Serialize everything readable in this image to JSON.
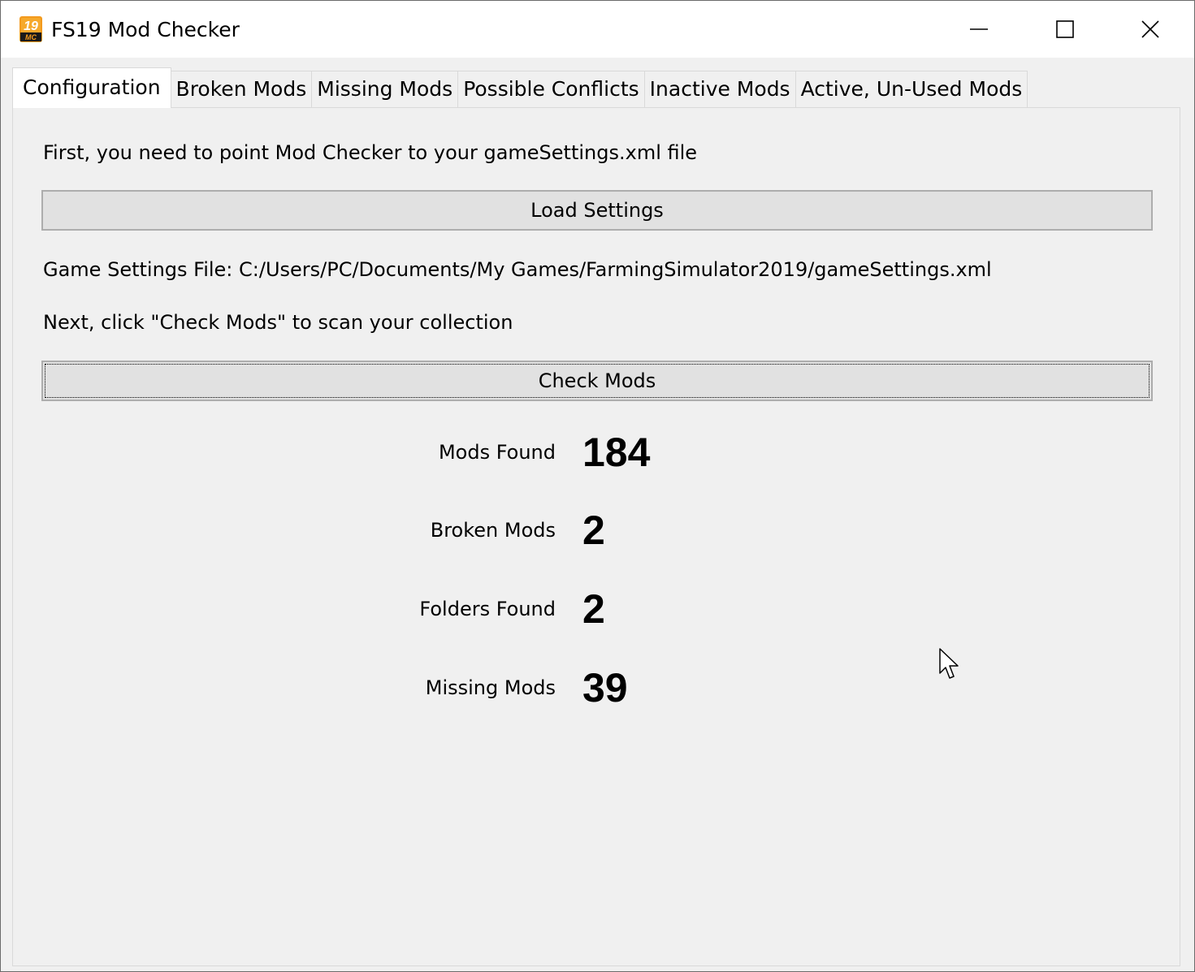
{
  "window": {
    "title": "FS19 Mod Checker",
    "icon_text": "19 MC"
  },
  "tabs": [
    {
      "label": "Configuration",
      "active": true
    },
    {
      "label": "Broken Mods",
      "active": false
    },
    {
      "label": "Missing Mods",
      "active": false
    },
    {
      "label": "Possible Conflicts",
      "active": false
    },
    {
      "label": "Inactive Mods",
      "active": false
    },
    {
      "label": "Active, Un-Used Mods",
      "active": false
    }
  ],
  "config": {
    "intro_text": "First, you need to point Mod Checker to your gameSettings.xml file",
    "load_button": "Load Settings",
    "settings_file_text": "Game Settings File: C:/Users/PC/Documents/My Games/FarmingSimulator2019/gameSettings.xml",
    "next_text": "Next, click \"Check Mods\" to scan your collection",
    "check_button": "Check Mods"
  },
  "stats": [
    {
      "label": "Mods Found",
      "value": "184"
    },
    {
      "label": "Broken Mods",
      "value": "2"
    },
    {
      "label": "Folders Found",
      "value": "2"
    },
    {
      "label": "Missing Mods",
      "value": "39"
    }
  ],
  "icons": {
    "app": "fs19-mod-checker-logo-icon",
    "minimize": "minimize-icon",
    "maximize": "maximize-icon",
    "close": "close-icon",
    "cursor": "mouse-pointer-icon"
  },
  "colors": {
    "window_bg": "#f0f0f0",
    "titlebar_bg": "#ffffff",
    "button_bg": "#e1e1e1",
    "button_border": "#adadad",
    "logo_orange": "#f39a1e"
  }
}
